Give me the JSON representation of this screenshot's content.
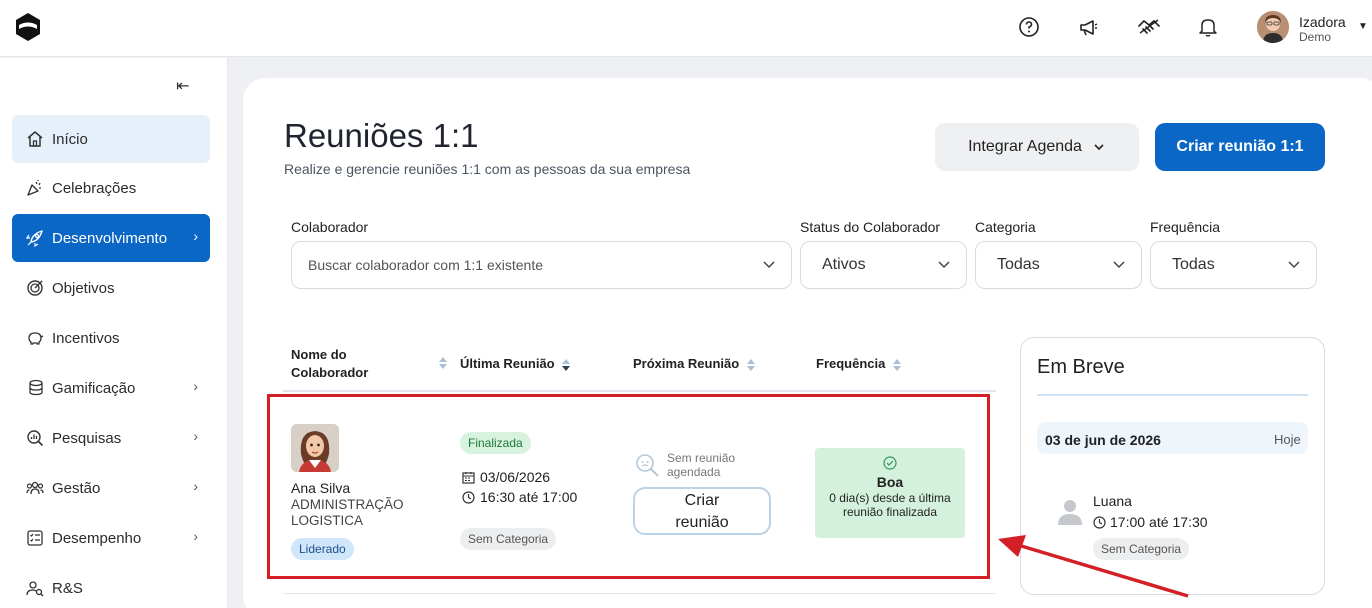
{
  "topbar": {
    "icons": [
      "help-icon",
      "megaphone-icon",
      "handshake-icon",
      "bell-icon"
    ],
    "user_name": "Izadora",
    "user_sub": "Demo"
  },
  "sidebar": {
    "items": [
      {
        "label": "Início",
        "icon": "home-icon"
      },
      {
        "label": "Celebrações",
        "icon": "party-icon"
      },
      {
        "label": "Desenvolvimento",
        "icon": "rocket-icon"
      },
      {
        "label": "Objetivos",
        "icon": "target-icon"
      },
      {
        "label": "Incentivos",
        "icon": "piggy-bank-icon"
      },
      {
        "label": "Gamificação",
        "icon": "coins-icon"
      },
      {
        "label": "Pesquisas",
        "icon": "search-chart-icon"
      },
      {
        "label": "Gestão",
        "icon": "people-icon"
      },
      {
        "label": "Desempenho",
        "icon": "checklist-icon"
      },
      {
        "label": "R&S",
        "icon": "user-search-icon"
      }
    ]
  },
  "page": {
    "title": "Reuniões 1:1",
    "subtitle": "Realize e gerencie reuniões 1:1 com as pessoas da sua empresa",
    "integrar_label": "Integrar Agenda",
    "criar_label": "Criar reunião 1:1"
  },
  "filters": {
    "colaborador_label": "Colaborador",
    "colaborador_placeholder": "Buscar colaborador com 1:1 existente",
    "status_label": "Status do Colaborador",
    "status_value": "Ativos",
    "categoria_label": "Categoria",
    "categoria_value": "Todas",
    "frequencia_label": "Frequência",
    "frequencia_value": "Todas"
  },
  "table": {
    "headers": {
      "nome_line1": "Nome do",
      "nome_line2": "Colaborador",
      "ultima": "Última Reunião",
      "proxima": "Próxima Reunião",
      "frequencia": "Frequência"
    },
    "row": {
      "name": "Ana Silva",
      "dept": "ADMINISTRAÇÃO LOGISTICA",
      "role_tag": "Liderado",
      "status_tag": "Finalizada",
      "date": "03/06/2026",
      "time": "16:30 até 17:00",
      "category_tag": "Sem Categoria",
      "no_meeting_line1": "Sem reunião",
      "no_meeting_line2": "agendada",
      "create_line1": "Criar",
      "create_line2": "reunião",
      "freq_title": "Boa",
      "freq_desc": "0 dia(s) desde a última reunião finalizada"
    }
  },
  "breve": {
    "title": "Em Breve",
    "date": "03 de jun de 2026",
    "today": "Hoje",
    "name": "Luana",
    "time_start": "17:00",
    "time_sep": "até",
    "time_end": "17:30",
    "category_tag": "Sem Categoria"
  },
  "colors": {
    "primary": "#0b67c6",
    "highlight": "#d31f26",
    "success_bg": "#d4f1dd"
  }
}
